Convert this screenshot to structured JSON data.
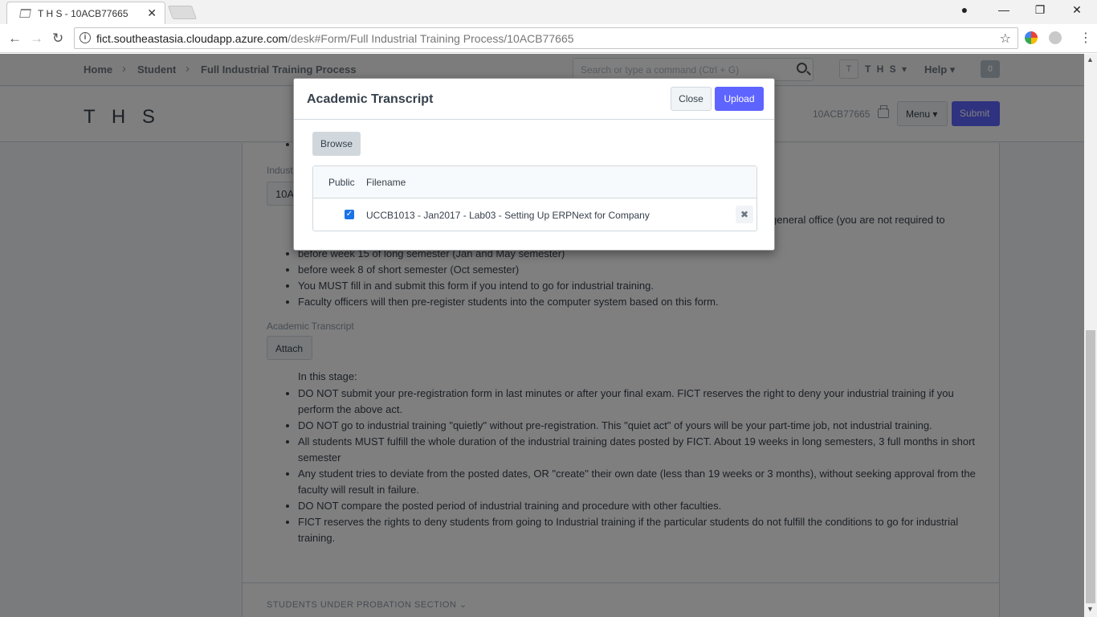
{
  "browser": {
    "tab_title": "T H S - 10ACB77665",
    "url_host": "fict.southeastasia.cloudapp.azure.com",
    "url_path": "/desk#Form/Full Industrial Training Process/10ACB77665"
  },
  "navbar": {
    "breadcrumbs": [
      "Home",
      "Student",
      "Full Industrial Training Process"
    ],
    "search_placeholder": "Search or type a command (Ctrl + G)",
    "avatar_letter": "T",
    "user_label": "T H S",
    "help_label": "Help",
    "notification_count": "0"
  },
  "page_head": {
    "title": "T H S",
    "doc_name": "10ACB77665",
    "menu_label": "Menu",
    "submit_label": "Submit"
  },
  "form": {
    "industrial_label": "Industrial",
    "industrial_value": "10ACB77665",
    "partial_text": "general office (you are not required to",
    "bullets_top": [
      "before week 15 of long semester (Jan and May semester)",
      "before week 8 of short semester (Oct semester)",
      "You MUST fill in and submit this form if you intend to go for industrial training.",
      "Faculty officers will then pre-register students into the computer system based on this form."
    ],
    "transcript_label": "Academic Transcript",
    "attach_label": "Attach",
    "stage_intro": "In this stage:",
    "bullets_stage": [
      "DO NOT submit your pre-registration form in last minutes or after your final exam. FICT reserves the right to deny your industrial training if you perform the above act.",
      "DO NOT go to industrial training \"quietly\" without pre-registration. This \"quiet act\" of yours will be your part-time job, not industrial training.",
      "All students MUST fulfill the whole duration of the industrial training dates posted by FICT. About 19 weeks in long semesters, 3 full months in short semester",
      "Any student tries to deviate from the posted dates, OR \"create\" their own date (less than 19 weeks or 3 months), without seeking approval from the faculty will result in failure.",
      "DO NOT compare the posted period of industrial training and procedure with other faculties.",
      "FICT reserves the rights to deny students from going to Industrial training if the particular students do not fulfill the conditions to go for industrial training."
    ],
    "section_heading": "STUDENTS UNDER PROBATION SECTION"
  },
  "modal": {
    "title": "Academic Transcript",
    "close_label": "Close",
    "upload_label": "Upload",
    "browse_label": "Browse",
    "col_public": "Public",
    "col_filename": "Filename",
    "file_name": "UCCB1013 - Jan2017 - Lab03 - Setting Up ERPNext for Company Op",
    "file_public": true
  },
  "colors": {
    "primary": "#5e64ff",
    "checkbox": "#1a73e8",
    "backdrop": "rgba(0,0,0,0.5)"
  }
}
